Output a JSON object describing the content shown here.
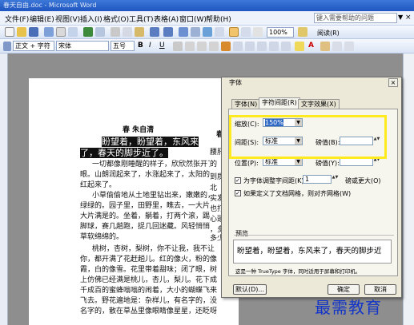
{
  "window": {
    "title": "春天自由.doc - Microsoft Word"
  },
  "menu": {
    "items": [
      "文件(F)",
      "编辑(E)",
      "视图(V)",
      "插入(I)",
      "格式(O)",
      "工具(T)",
      "表格(A)",
      "窗口(W)",
      "帮助(H)"
    ],
    "help_placeholder": "键入需要帮助的问题",
    "help_arrow": "▼",
    "close": "×"
  },
  "toolbar": {
    "zoom": "100%",
    "read_label": "阅读(R)",
    "style": "正文 + 字符",
    "font": "宋体",
    "size": "五号",
    "bold": "B",
    "italic": "I",
    "underline": "U",
    "font_color_glyph": "A"
  },
  "document": {
    "title": "春  朱自清",
    "highlight_lines": [
      "盼望着，盼望着，东风来",
      "了，春天的脚步近了。"
    ],
    "lines": [
      "一切都像刚睡醒的样子，欣欣然张开了",
      "眼。山朗润起来了，水涨起来了，太阳的脸",
      "红起来了。",
      "小草偷偷地从土地里钻出来，嫩嫩的，",
      "绿绿的。园子里，田野里，瞧去，一大片一",
      "大片满是的。坐着，躺着，打两个滚，踢几",
      "脚球，赛几趟跑，捉几回迷藏。风轻悄悄的，",
      "草软绵绵的。",
      "桃树，杏树，梨树，你不让我，我不让",
      "你，都开满了花赶趟儿。红的像火，粉的像",
      "霞，白的像雪。花里带着甜味；闭了眼，树",
      "上仿佛已经满是桃儿，杏儿，梨儿。花下成",
      "千成百的蜜蜂嗡嗡的闹着，大小的蝴蝶飞来",
      "飞去。野花遍地是：杂样儿，有名字的，没",
      "名字的，散在草丛里像眼睛像星星，还眨呀"
    ],
    "right_fragments": [
      "春",
      "腰肝",
      "的",
      "到质",
      "北",
      "实发",
      "也打",
      "心頭",
      "，多",
      "多少"
    ]
  },
  "dialog": {
    "title": "字体",
    "close": "×",
    "tabs": [
      "字体(N)",
      "字符间距(R)",
      "文字效果(X)"
    ],
    "scale_label": "缩放(C):",
    "scale_value": "150%",
    "spacing_label": "间距(S):",
    "spacing_value": "标准",
    "spacing_by_label": "磅值(B):",
    "position_label": "位置(P):",
    "position_value": "标准",
    "position_by_label": "磅值(Y):",
    "kerning_label": "为字体调整字间距(K):",
    "kerning_value": "1",
    "kerning_suffix": "磅或更大(O)",
    "kerning_checked": true,
    "grid_label": "如果定义了文档网格，则对齐网格(W)",
    "grid_checked": true,
    "preview_label": "预览",
    "preview_text": "盼望着，盼望着，东风来了，春天的脚步近",
    "note": "这是一种 TrueType 字体，同时适用于屏幕和打印机。",
    "default_button": "默认(D)...",
    "ok_button": "确定",
    "cancel_button": "取消",
    "dropdown_glyph": "▼",
    "spin_glyph": "▲▼",
    "check_glyph": "✓"
  },
  "watermark": {
    "text": "最需教育"
  },
  "colors": {
    "highlight": "#ffea1f",
    "watermark": "#1234c8",
    "title_bar": "#2a62c9"
  }
}
